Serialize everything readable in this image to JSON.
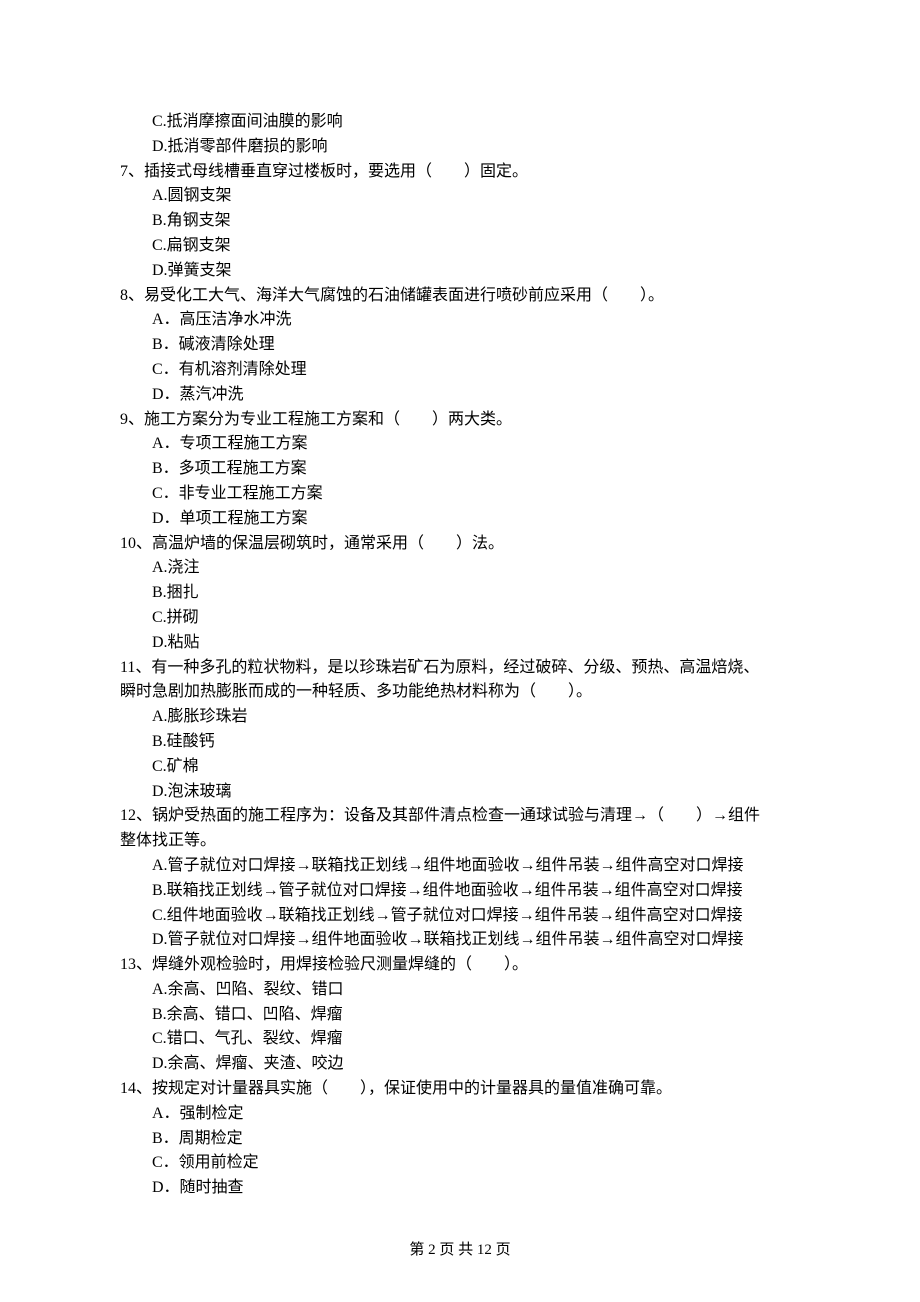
{
  "pre_options": {
    "C": "C.抵消摩擦面间油膜的影响",
    "D": "D.抵消零部件磨损的影响"
  },
  "q7": {
    "stem": "7、插接式母线槽垂直穿过楼板时，要选用（　　）固定。",
    "A": "A.圆钢支架",
    "B": "B.角钢支架",
    "C": "C.扁钢支架",
    "D": "D.弹簧支架"
  },
  "q8": {
    "stem": "8、易受化工大气、海洋大气腐蚀的石油储罐表面进行喷砂前应采用（　　）。",
    "A": "A．高压洁净水冲洗",
    "B": "B．碱液清除处理",
    "C": "C．有机溶剂清除处理",
    "D": "D．蒸汽冲洗"
  },
  "q9": {
    "stem": "9、施工方案分为专业工程施工方案和（　　）两大类。",
    "A": "A．专项工程施工方案",
    "B": "B．多项工程施工方案",
    "C": "C．非专业工程施工方案",
    "D": "D．单项工程施工方案"
  },
  "q10": {
    "stem": "10、高温炉墙的保温层砌筑时，通常采用（　　）法。",
    "A": "A.浇注",
    "B": "B.捆扎",
    "C": "C.拼砌",
    "D": "D.粘贴"
  },
  "q11": {
    "stem": "11、有一种多孔的粒状物料，是以珍珠岩矿石为原料，经过破碎、分级、预热、高温焙烧、",
    "stem2": "瞬时急剧加热膨胀而成的一种轻质、多功能绝热材料称为（　　）。",
    "A": "A.膨胀珍珠岩",
    "B": "B.硅酸钙",
    "C": "C.矿棉",
    "D": "D.泡沫玻璃"
  },
  "q12": {
    "stem": "12、锅炉受热面的施工程序为：设备及其部件清点检查一通球试验与清理→（　　）→组件",
    "stem2": "整体找正等。",
    "A": "A.管子就位对口焊接→联箱找正划线→组件地面验收→组件吊装→组件高空对口焊接",
    "B": "B.联箱找正划线→管子就位对口焊接→组件地面验收→组件吊装→组件高空对口焊接",
    "C": "C.组件地面验收→联箱找正划线→管子就位对口焊接→组件吊装→组件高空对口焊接",
    "D": "D.管子就位对口焊接→组件地面验收→联箱找正划线→组件吊装→组件高空对口焊接"
  },
  "q13": {
    "stem": "13、焊缝外观检验时，用焊接检验尺测量焊缝的（　　）。",
    "A": "A.余高、凹陷、裂纹、错口",
    "B": "B.余高、错口、凹陷、焊瘤",
    "C": "C.错口、气孔、裂纹、焊瘤",
    "D": "D.余高、焊瘤、夹渣、咬边"
  },
  "q14": {
    "stem": "14、按规定对计量器具实施（　　），保证使用中的计量器具的量值准确可靠。",
    "A": "A．强制检定",
    "B": "B．周期检定",
    "C": "C．领用前检定",
    "D": "D．随时抽查"
  },
  "footer": "第 2 页 共 12 页"
}
